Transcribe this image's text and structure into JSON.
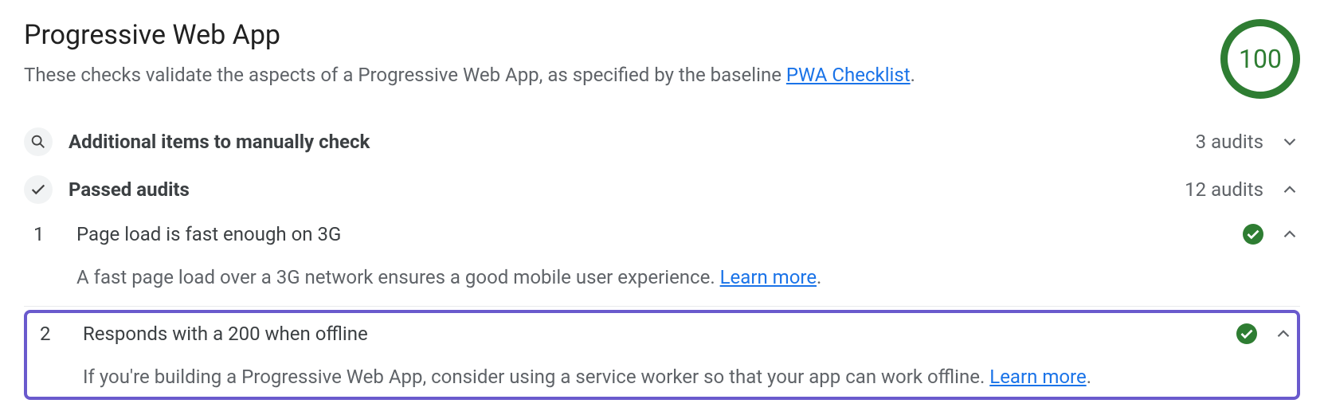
{
  "header": {
    "title": "Progressive Web App",
    "description_prefix": "These checks validate the aspects of a Progressive Web App, as specified by the baseline ",
    "description_link": "PWA Checklist",
    "description_suffix": ".",
    "score": "100"
  },
  "groups": {
    "manual": {
      "label": "Additional items to manually check",
      "count": "3 audits"
    },
    "passed": {
      "label": "Passed audits",
      "count": "12 audits"
    }
  },
  "audits": [
    {
      "number": "1",
      "title": "Page load is fast enough on 3G",
      "description_prefix": "A fast page load over a 3G network ensures a good mobile user experience. ",
      "learn_more": "Learn more",
      "description_suffix": "."
    },
    {
      "number": "2",
      "title": "Responds with a 200 when offline",
      "description_prefix": "If you're building a Progressive Web App, consider using a service worker so that your app can work offline. ",
      "learn_more": "Learn more",
      "description_suffix": "."
    }
  ]
}
